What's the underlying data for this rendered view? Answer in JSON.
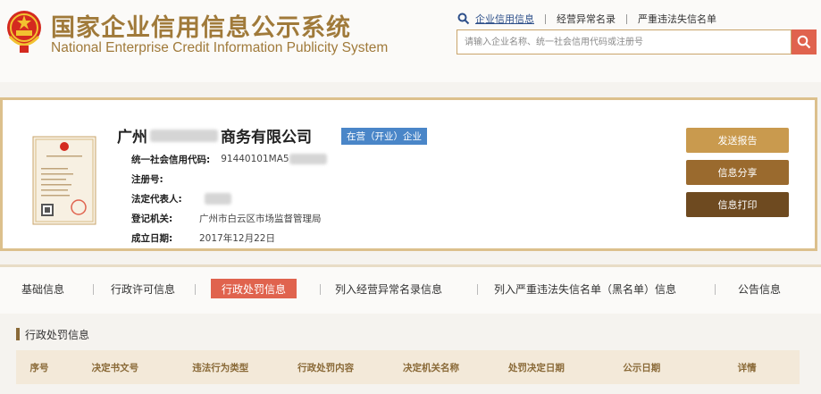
{
  "header": {
    "title_cn": "国家企业信用信息公示系统",
    "title_en": "National Enterprise Credit Information Publicity System",
    "links": [
      "企业信用信息",
      "经营异常名录",
      "严重违法失信名单"
    ],
    "search_placeholder": "请输入企业名称、统一社会信用代码或注册号"
  },
  "company": {
    "name_prefix": "广州",
    "name_suffix": "商务有限公司",
    "status": "在营（开业）企业",
    "fields": [
      {
        "label": "统一社会信用代码:",
        "value": "91440101MA5"
      },
      {
        "label": "注册号:",
        "value": ""
      },
      {
        "label": "法定代表人:",
        "value": ""
      },
      {
        "label": "登记机关:",
        "value": "广州市白云区市场监督管理局"
      },
      {
        "label": "成立日期:",
        "value": "2017年12月22日"
      }
    ],
    "license_text": "营 业 执 照"
  },
  "actions": {
    "send_report": "发送报告",
    "share": "信息分享",
    "print": "信息打印"
  },
  "tabs": [
    {
      "label": "基础信息"
    },
    {
      "label": "行政许可信息"
    },
    {
      "label": "行政处罚信息",
      "active": true
    },
    {
      "label": "列入经营异常名录信息"
    },
    {
      "label": "列入严重违法失信名单（黑名单）信息"
    },
    {
      "label": "公告信息"
    }
  ],
  "section": {
    "title": "行政处罚信息",
    "columns": [
      "序号",
      "决定书文号",
      "违法行为类型",
      "行政处罚内容",
      "决定机关名称",
      "处罚决定日期",
      "公示日期",
      "详情"
    ]
  },
  "colors": {
    "gold": "#a07a3a",
    "accent_red": "#e0634e",
    "badge_blue": "#4a86c8"
  }
}
